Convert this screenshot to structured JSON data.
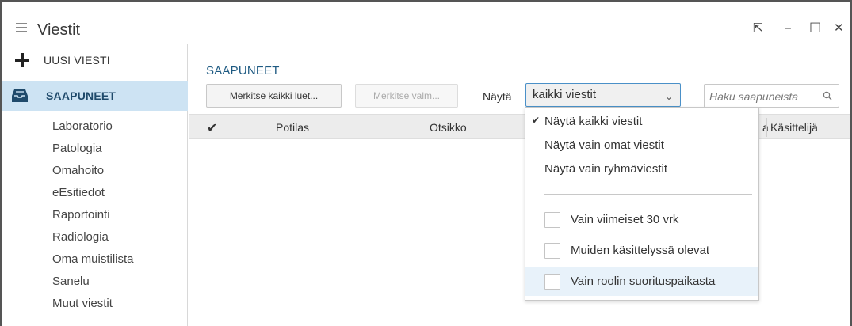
{
  "window": {
    "title": "Viestit",
    "controls": {
      "popout": "⇱",
      "minimize": "–",
      "maximize": "☐",
      "close": "✕"
    }
  },
  "sidebar": {
    "new_message_label": "UUSI VIESTI",
    "inbox_label": "SAAPUNEET",
    "folders": [
      "Laboratorio",
      "Patologia",
      "Omahoito",
      "eEsitiedot",
      "Raportointi",
      "Radiologia",
      "Oma muistilista",
      "Sanelu",
      "Muut viestit"
    ]
  },
  "main": {
    "section_title": "SAAPUNEET",
    "mark_all_read_button": "Merkitse kaikki luet...",
    "mark_selected_button": "Merkitse valm...",
    "show_label": "Näytä",
    "filter_select_value": "kaikki viestit",
    "search_placeholder": "Haku saapuneista",
    "columns": {
      "patient": "Potilas",
      "subject": "Otsikko",
      "partial": "a",
      "handler": "Käsittelijä"
    }
  },
  "dropdown": {
    "options": [
      {
        "label": "Näytä kaikki viestit",
        "checked": true
      },
      {
        "label": "Näytä vain omat viestit",
        "checked": false
      },
      {
        "label": "Näytä vain ryhmäviestit",
        "checked": false
      }
    ],
    "checkboxes": [
      {
        "label": "Vain viimeiset 30 vrk",
        "checked": false
      },
      {
        "label": "Muiden käsittelyssä olevat",
        "checked": false
      },
      {
        "label": "Vain roolin suorituspaikasta",
        "checked": false
      }
    ]
  },
  "colors": {
    "accent": "#1e5a82",
    "selected_bg": "#cde3f3",
    "select_border": "#4a90c8",
    "header_bg": "#ececec"
  },
  "icons": {
    "menu": "hamburger-icon",
    "new": "plus-icon",
    "inbox": "inbox-icon",
    "search": "search-icon",
    "check": "check-icon"
  }
}
